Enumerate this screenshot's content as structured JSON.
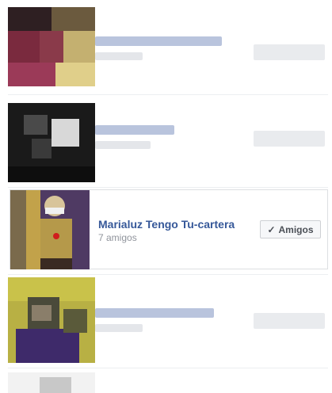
{
  "card": {
    "name": "Marialuz Tengo Tu-cartera",
    "friend_count": "7 amigos",
    "friend_button": {
      "label": "Amigos",
      "icon": "check-icon"
    }
  },
  "colors": {
    "link_blue": "#365899",
    "meta_gray": "#90949c",
    "button_bg": "#f6f7f9",
    "button_border": "#ced0d4"
  }
}
